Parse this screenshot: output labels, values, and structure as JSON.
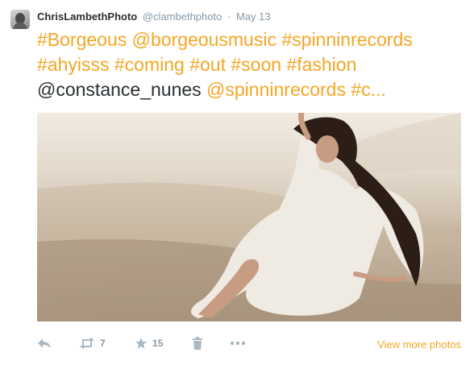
{
  "tweet": {
    "display_name": "ChrisLambethPhoto",
    "username": "@clambethphoto",
    "separator": "·",
    "time": "May 13",
    "text_parts": [
      {
        "text": "#Borgeous",
        "highlight": true
      },
      {
        "text": " ",
        "highlight": false
      },
      {
        "text": "@borgeousmusic",
        "highlight": true
      },
      {
        "text": " ",
        "highlight": false
      },
      {
        "text": "#spinninrecords",
        "highlight": true
      },
      {
        "text": " ",
        "highlight": false
      },
      {
        "text": "#ahyisss",
        "highlight": true
      },
      {
        "text": " ",
        "highlight": false
      },
      {
        "text": "#coming",
        "highlight": true
      },
      {
        "text": " ",
        "highlight": false
      },
      {
        "text": "#out",
        "highlight": true
      },
      {
        "text": " ",
        "highlight": false
      },
      {
        "text": "#soon",
        "highlight": true
      },
      {
        "text": " ",
        "highlight": false
      },
      {
        "text": "#fashion",
        "highlight": true
      },
      {
        "text": " ",
        "highlight": false
      },
      {
        "text": "@constance_nunes",
        "highlight": false
      },
      {
        "text": " ",
        "highlight": false
      },
      {
        "text": "@spinninrecords",
        "highlight": true
      },
      {
        "text": " ",
        "highlight": false
      },
      {
        "text": "#c...",
        "highlight": true
      }
    ]
  },
  "actions": {
    "reply_icon": "reply-icon",
    "retweet_icon": "retweet-icon",
    "retweet_count": "7",
    "favorite_icon": "star-icon",
    "favorite_count": "15",
    "delete_icon": "trash-icon",
    "more_icon": "more-dots-icon",
    "view_more_label": "View more photos"
  },
  "colors": {
    "accent": "#f5a623",
    "text": "#292f33",
    "muted": "#8899a6",
    "icon": "#aab8c2"
  }
}
